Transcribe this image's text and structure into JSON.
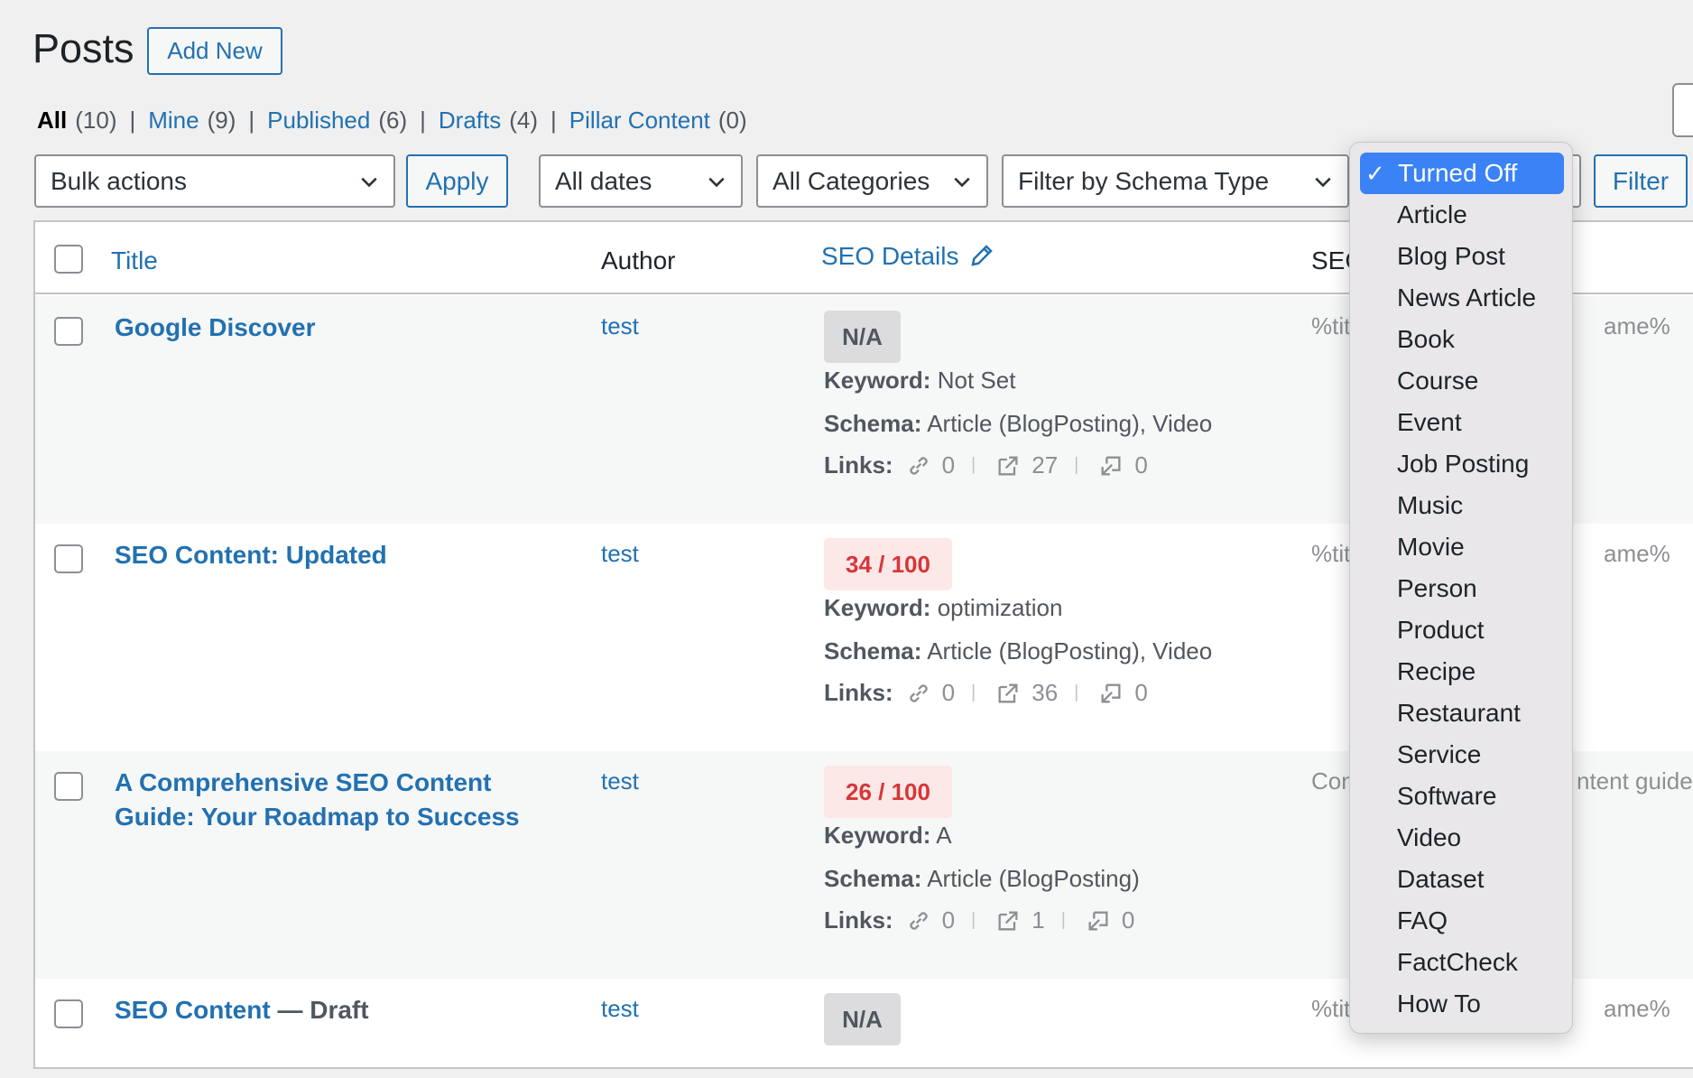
{
  "header": {
    "title": "Posts",
    "add_new_label": "Add New"
  },
  "status_filters": [
    {
      "label": "All",
      "count": "(10)",
      "current": true
    },
    {
      "label": "Mine",
      "count": "(9)"
    },
    {
      "label": "Published",
      "count": "(6)"
    },
    {
      "label": "Drafts",
      "count": "(4)"
    },
    {
      "label": "Pillar Content",
      "count": "(0)"
    }
  ],
  "toolbar": {
    "bulk_actions": "Bulk actions",
    "apply_label": "Apply",
    "dates": "All dates",
    "categories": "All Categories",
    "schema_filter": "Filter by Schema Type",
    "filter_label": "Filter"
  },
  "table": {
    "columns": {
      "title": "Title",
      "author": "Author",
      "seo_details": "SEO Details",
      "seo_partial": "SEC"
    },
    "labels": {
      "keyword": "Keyword:",
      "schema": "Schema:",
      "links": "Links:"
    },
    "rows": [
      {
        "title": "Google Discover",
        "author": "test",
        "score": "N/A",
        "keyword": "Not Set",
        "schema": "Article (BlogPosting), Video",
        "links_internal": "0",
        "links_external": "27",
        "links_incoming": "0",
        "seo_left": "%tit",
        "seo_right": "ame%"
      },
      {
        "title": "SEO Content: Updated",
        "author": "test",
        "score": "34 / 100",
        "keyword": "optimization",
        "schema": "Article (BlogPosting), Video",
        "links_internal": "0",
        "links_external": "36",
        "links_incoming": "0",
        "seo_left": "%tit",
        "seo_right": "ame%"
      },
      {
        "title": "A Comprehensive SEO Content Guide: Your Roadmap to Success",
        "author": "test",
        "score": "26 / 100",
        "keyword": "A",
        "schema": "Article (BlogPosting)",
        "links_internal": "0",
        "links_external": "1",
        "links_incoming": "0",
        "seo_left": "Con",
        "seo_right": "ntent guide"
      },
      {
        "title": "SEO Content",
        "state": " — Draft",
        "author": "test",
        "score": "N/A",
        "seo_left": "%tit",
        "seo_right": "ame%"
      }
    ]
  },
  "schema_dropdown": {
    "selected": "Turned Off",
    "options": [
      "Article",
      "Blog Post",
      "News Article",
      "Book",
      "Course",
      "Event",
      "Job Posting",
      "Music",
      "Movie",
      "Person",
      "Product",
      "Recipe",
      "Restaurant",
      "Service",
      "Software",
      "Video",
      "Dataset",
      "FAQ",
      "FactCheck",
      "How To"
    ]
  },
  "colors": {
    "link": "#2271b1",
    "score_bad_bg": "#fde8e8",
    "score_bad_text": "#d63638",
    "selection": "#3a82f6"
  }
}
